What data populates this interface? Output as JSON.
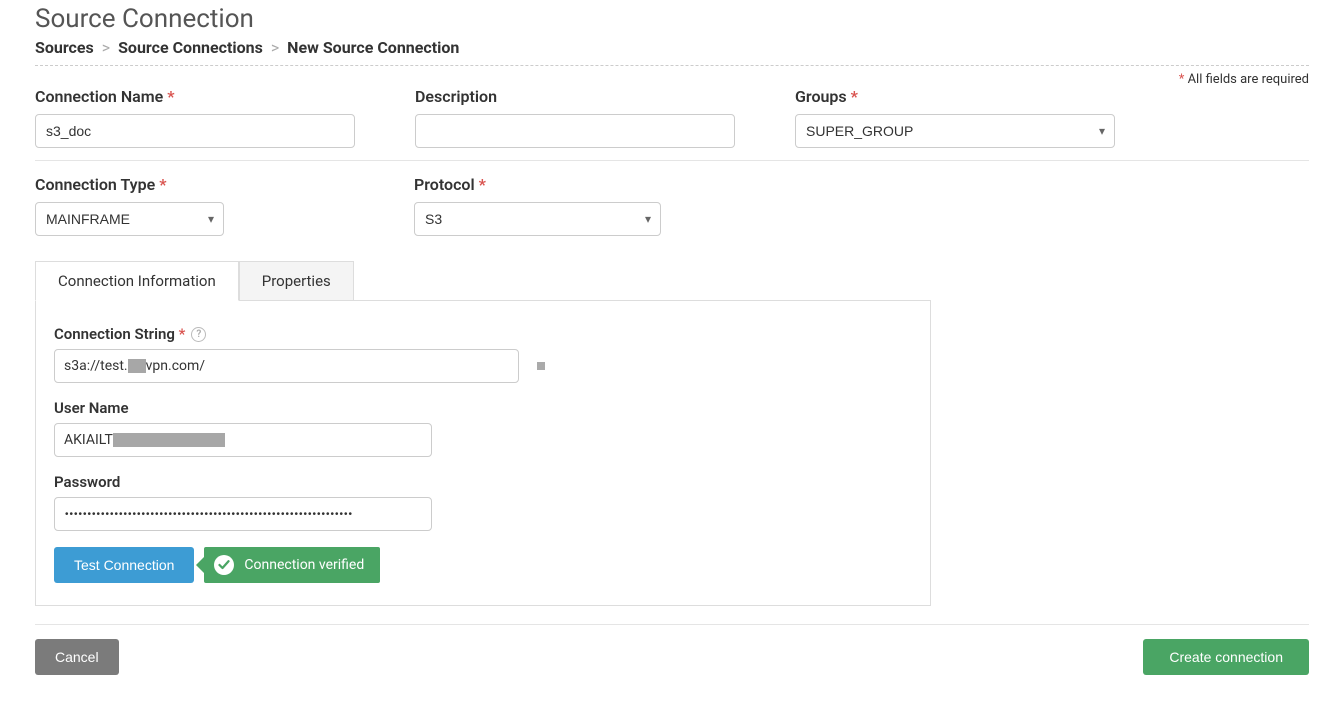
{
  "header": {
    "title": "Source Connection",
    "breadcrumb": [
      "Sources",
      "Source Connections",
      "New Source Connection"
    ],
    "required_note": "All fields are required"
  },
  "form": {
    "connection_name": {
      "label": "Connection Name",
      "value": "s3_doc"
    },
    "description": {
      "label": "Description",
      "value": ""
    },
    "groups": {
      "label": "Groups",
      "selected": "SUPER_GROUP"
    },
    "connection_type": {
      "label": "Connection Type",
      "selected": "MAINFRAME"
    },
    "protocol": {
      "label": "Protocol",
      "selected": "S3"
    }
  },
  "tabs": {
    "info": "Connection Information",
    "props": "Properties"
  },
  "conn_info": {
    "connection_string": {
      "label": "Connection String",
      "prefix": "s3a://test.",
      "suffix": "vpn.com/"
    },
    "user_name": {
      "label": "User Name",
      "prefix": "AKIAILT"
    },
    "password": {
      "label": "Password",
      "value": "••••••••••••••••••••••••••••••••••••••••••••••••••••••••••••••••"
    }
  },
  "actions": {
    "test": "Test Connection",
    "verified": "Connection verified",
    "cancel": "Cancel",
    "create": "Create connection"
  }
}
